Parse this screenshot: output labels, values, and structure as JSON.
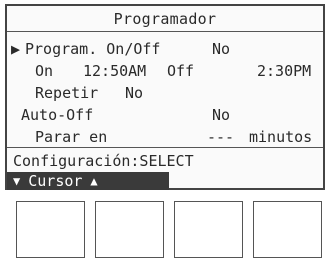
{
  "screen": {
    "title": "Programador",
    "arrow": "▶",
    "row1": {
      "label": "Program. On/Off",
      "value": "No"
    },
    "row2": {
      "on_label": "On",
      "on_time": "12:50AM",
      "off_label": "Off",
      "off_time": "2:30PM"
    },
    "row3": {
      "label": "Repetir",
      "value": "No"
    },
    "row4": {
      "label": "Auto-Off",
      "value": "No"
    },
    "row5": {
      "label": "Parar en",
      "value": "---",
      "unit": "minutos"
    },
    "footer": "Configuración:SELECT",
    "cursor": {
      "down_glyph": "▼",
      "label": "Cursor",
      "up_glyph": "▲"
    }
  },
  "function_buttons": [
    "",
    "",
    "",
    ""
  ]
}
